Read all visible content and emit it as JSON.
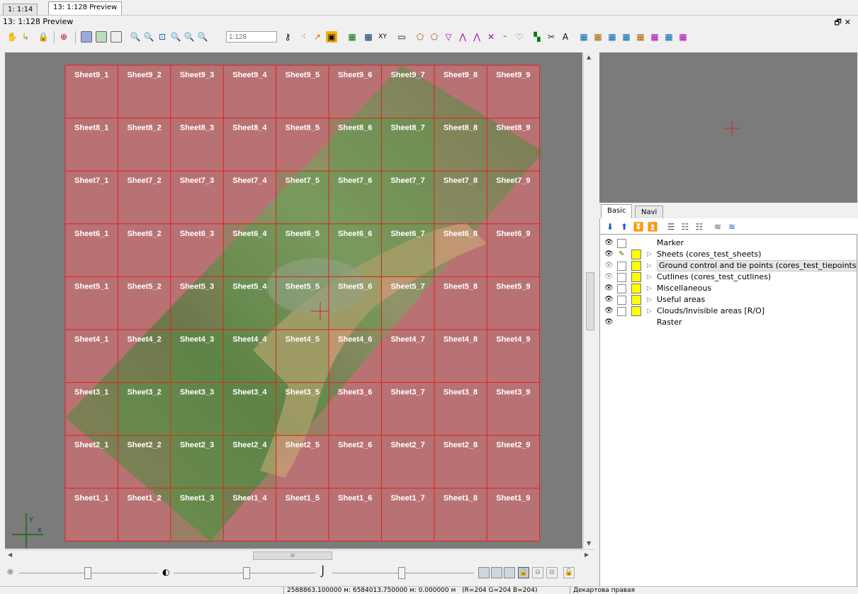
{
  "tabs": [
    {
      "label": "1: 1:14"
    },
    {
      "label": "13: 1:128 Preview"
    }
  ],
  "window": {
    "title": "13: 1:128 Preview",
    "buttons": [
      "restore-icon",
      "close-icon"
    ]
  },
  "toolbar": {
    "scale_placeholder": "1:128"
  },
  "map": {
    "grid_rows": [
      "9",
      "8",
      "7",
      "6",
      "5",
      "4",
      "3",
      "2",
      "1"
    ],
    "grid_cols": [
      "1",
      "2",
      "3",
      "4",
      "5",
      "6",
      "7",
      "8",
      "9"
    ],
    "sheet_prefix": "Sheet",
    "axis_y": "Y",
    "axis_x": "X",
    "grid_color": "#e02020",
    "fill_color": "#c07070",
    "highlight_color": "#22cc22"
  },
  "side_tabs": [
    {
      "label": "Basic"
    },
    {
      "label": "Navi"
    }
  ],
  "layers": [
    {
      "label": "Marker"
    },
    {
      "label": "Sheets (cores_test_sheets)"
    },
    {
      "label": "Ground control and tie points (cores_test_tiepoints)"
    },
    {
      "label": "Cutlines (cores_test_cutlines)"
    },
    {
      "label": "Miscellaneous"
    },
    {
      "label": "Useful areas"
    },
    {
      "label": "Clouds/Invisible areas [R/O]"
    },
    {
      "label": "Raster"
    }
  ],
  "scrollbar": {
    "h_label": "III"
  },
  "status": {
    "coords": "2588863.100000 м: 6584013.750000 м: 0.000000 м",
    "rgb": "(R=204 G=204 B=204)",
    "system": "Декартова правая"
  }
}
